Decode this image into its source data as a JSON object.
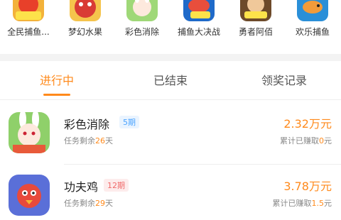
{
  "games": [
    {
      "name": "全民捕鱼...",
      "icon": "fishing-game-icon",
      "color": "#e8402a"
    },
    {
      "name": "梦幻水果",
      "icon": "fruit-game-icon",
      "color": "#d93b35"
    },
    {
      "name": "彩色消除",
      "icon": "bunny-girl-game-icon",
      "color": "#7cc35c"
    },
    {
      "name": "捕鱼大决战",
      "icon": "fish-battle-game-icon",
      "color": "#1f6ac9"
    },
    {
      "name": "勇者阿佰",
      "icon": "hero-game-icon",
      "color": "#c58b32"
    },
    {
      "name": "欢乐捕鱼",
      "icon": "happy-fishing-game-icon",
      "color": "#2a8fd8"
    }
  ],
  "tabs": [
    {
      "label": "进行中",
      "active": true
    },
    {
      "label": "已结束",
      "active": false
    },
    {
      "label": "领奖记录",
      "active": false
    }
  ],
  "tasks": [
    {
      "title": "彩色消除",
      "period_badge": "5期",
      "remaining_prefix": "任务剩余",
      "remaining_days": "26",
      "remaining_suffix": "天",
      "amount": "2.32万元",
      "earned_prefix": "累计已赚取",
      "earned_value": "0",
      "earned_suffix": "元",
      "icon": "bunny-girl-app-icon",
      "badge_color": "#4aa3ff"
    },
    {
      "title": "功夫鸡",
      "period_badge": "12期",
      "remaining_prefix": "任务剩余",
      "remaining_days": "29",
      "remaining_suffix": "天",
      "amount": "3.78万元",
      "earned_prefix": "累计已赚取",
      "earned_value": "1.5",
      "earned_suffix": "元",
      "icon": "kungfu-chicken-app-icon",
      "badge_color": "#f06a6a"
    }
  ],
  "colors": {
    "accent": "#ff8a1c",
    "separator": "#f3f3f3"
  }
}
